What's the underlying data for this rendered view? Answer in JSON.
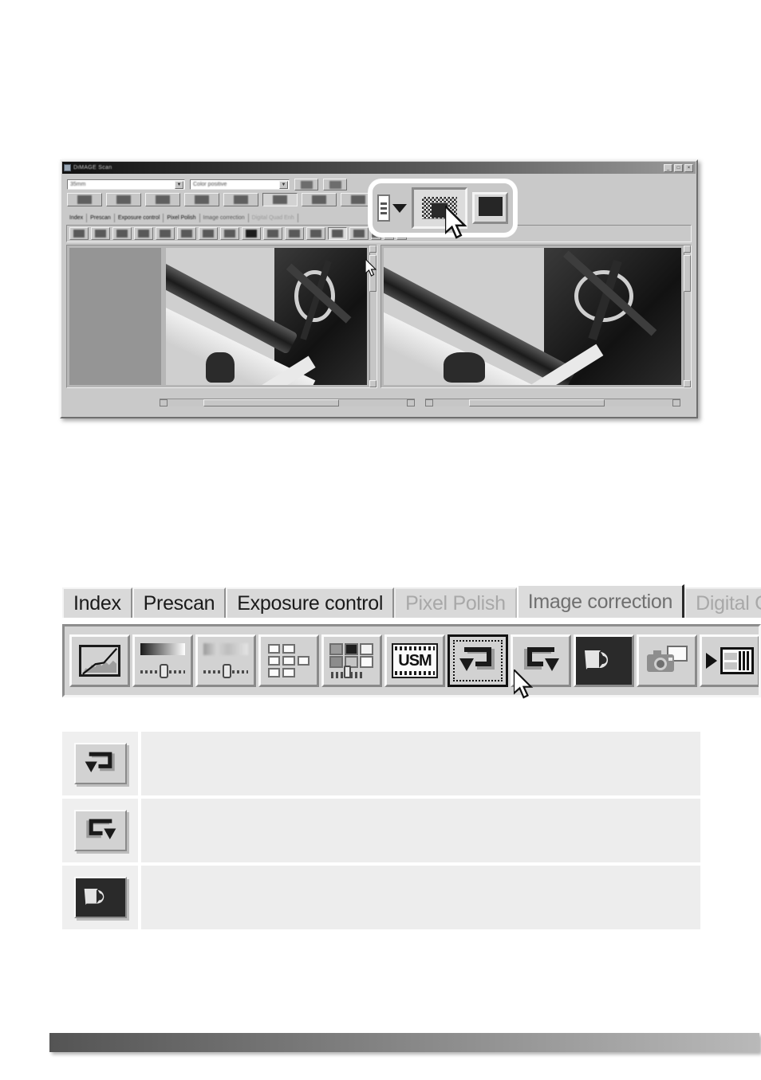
{
  "app_window": {
    "title": "DiMAGE Scan",
    "window_buttons": [
      "minimize",
      "maximize",
      "close"
    ],
    "controls": {
      "zoom_combo_value": "35mm",
      "mode_combo_value": "Color positive",
      "combo_arrow": "chevron-down-icon",
      "right_buttons": [
        "settings-icon",
        "monitor-icon"
      ],
      "function_buttons": [
        "index-scan-icon",
        "prescan-icon",
        "scan-icon",
        "eject-icon",
        "rotate-icon",
        "grid-icon",
        "save-icon",
        "help-icon"
      ]
    },
    "tabs": [
      {
        "label": "Index",
        "state": "normal"
      },
      {
        "label": "Prescan",
        "state": "normal"
      },
      {
        "label": "Exposure control",
        "state": "normal"
      },
      {
        "label": "Pixel Polish",
        "state": "normal"
      },
      {
        "label": "Image correction",
        "state": "active"
      },
      {
        "label": "Digital Quad Enh",
        "state": "disabled"
      }
    ],
    "toolbar_icons": [
      "tone-curve-icon",
      "brightness-contrast-icon",
      "hue-saturation-icon",
      "variation-icon",
      "selective-color-icon",
      "usm-icon",
      "rotate-left-icon",
      "flip-icon",
      "zoom-icon",
      "pan-icon",
      "fit-icon",
      "undo-icon",
      "redo-icon",
      "reset-icon",
      "snapshot-icon",
      "batch-icon"
    ],
    "panes": {
      "left_label": "before-image-pane",
      "right_label": "after-image-pane",
      "scrollbars": [
        "vertical-scrollbar",
        "horizontal-scrollbar"
      ]
    }
  },
  "callout": {
    "list_icon": "list-icon",
    "dropdown_arrow": "chevron-down-icon",
    "highlighted_button": "dithered-preview-icon",
    "monitor_button": "monitor-icon",
    "cursor": "arrow-cursor"
  },
  "tab_bar": {
    "tabs": [
      {
        "label": "Index",
        "state": "normal"
      },
      {
        "label": "Prescan",
        "state": "normal"
      },
      {
        "label": "Exposure control",
        "state": "normal"
      },
      {
        "label": "Pixel Polish",
        "state": "disabled"
      },
      {
        "label": "Image correction",
        "state": "active"
      },
      {
        "label": "Digital Gra",
        "state": "disabled"
      }
    ]
  },
  "big_toolbar": {
    "buttons": [
      {
        "name": "tone-curve-histogram-button",
        "icon": "tone-curve-icon",
        "state": "normal"
      },
      {
        "name": "brightness-contrast-button",
        "icon": "brightness-contrast-icon",
        "state": "normal"
      },
      {
        "name": "hue-saturation-button",
        "icon": "hue-saturation-icon",
        "state": "normal"
      },
      {
        "name": "variation-button",
        "icon": "variation-grid-icon",
        "state": "normal"
      },
      {
        "name": "selective-color-button",
        "icon": "selective-color-icon",
        "state": "normal"
      },
      {
        "name": "unsharp-mask-button",
        "icon": "usm-icon",
        "label": "USM",
        "state": "normal"
      },
      {
        "name": "undo-button",
        "icon": "undo-arrow-icon",
        "state": "selected"
      },
      {
        "name": "redo-button",
        "icon": "redo-arrow-icon",
        "state": "normal"
      },
      {
        "name": "reset-button",
        "icon": "reset-arrow-icon",
        "state": "normal"
      },
      {
        "name": "snapshot-button",
        "icon": "camera-icon",
        "state": "normal"
      },
      {
        "name": "batch-button",
        "icon": "play-film-icon",
        "state": "normal"
      }
    ],
    "cursor": "arrow-cursor"
  },
  "legend": {
    "rows": [
      {
        "icon": "undo-arrow-icon",
        "style": "normal",
        "description": ""
      },
      {
        "icon": "redo-arrow-icon",
        "style": "normal",
        "description": ""
      },
      {
        "icon": "reset-arrow-icon",
        "style": "inverted",
        "description": ""
      }
    ]
  },
  "footer": {
    "gradient_from": "#545454",
    "gradient_to": "#b9b9b9"
  }
}
